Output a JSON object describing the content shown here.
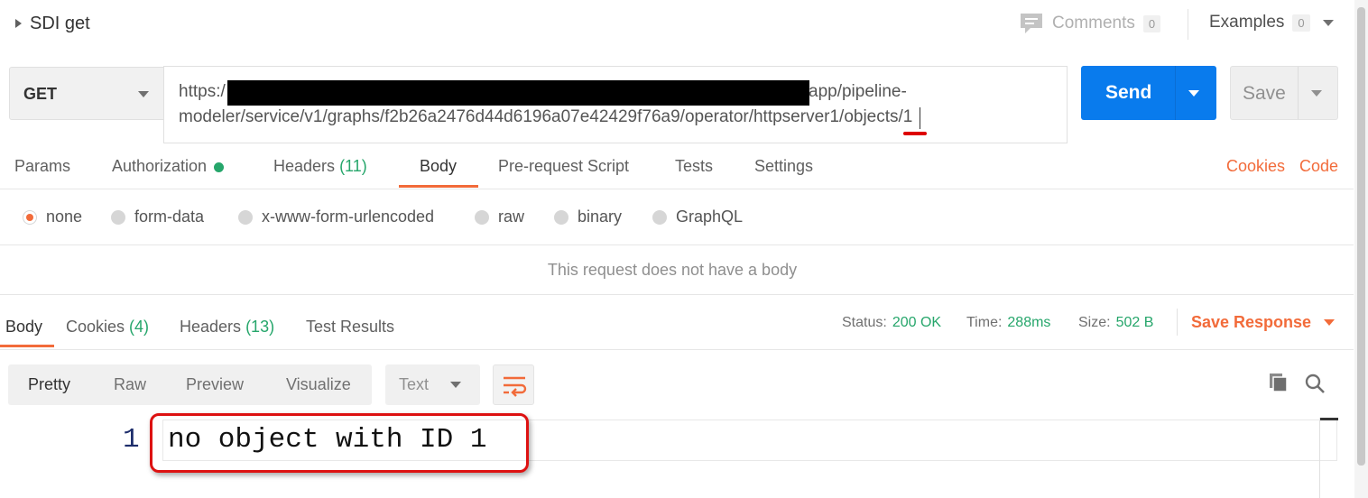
{
  "header": {
    "title": "SDI get",
    "comments_label": "Comments",
    "comments_count": "0",
    "examples_label": "Examples",
    "examples_count": "0"
  },
  "request": {
    "method": "GET",
    "url_line1_start": "https:/",
    "url_line1_end": "app/pipeline-",
    "url_line2": "modeler/service/v1/graphs/f2b26a2476d44d6196a07e42429f76a9/operator/httpserver1/objects/1",
    "send_label": "Send",
    "save_label": "Save"
  },
  "request_tabs": {
    "params": "Params",
    "authorization": "Authorization",
    "headers": "Headers",
    "headers_count": "(11)",
    "body": "Body",
    "pre_request": "Pre-request Script",
    "tests": "Tests",
    "settings": "Settings",
    "cookies_link": "Cookies",
    "code_link": "Code"
  },
  "body_types": {
    "selected": "none",
    "options": [
      "none",
      "form-data",
      "x-www-form-urlencoded",
      "raw",
      "binary",
      "GraphQL"
    ]
  },
  "no_body_message": "This request does not have a body",
  "response_tabs": {
    "body": "Body",
    "cookies": "Cookies",
    "cookies_count": "(4)",
    "headers": "Headers",
    "headers_count": "(13)",
    "test_results": "Test Results"
  },
  "response_status": {
    "status_label": "Status:",
    "status_value": "200 OK",
    "time_label": "Time:",
    "time_value": "288ms",
    "size_label": "Size:",
    "size_value": "502 B",
    "save_response": "Save Response"
  },
  "response_view": {
    "options": [
      "Pretty",
      "Raw",
      "Preview",
      "Visualize"
    ],
    "selected": "Pretty",
    "format": "Text"
  },
  "response_body": {
    "line_number": "1",
    "content": "no object with ID 1"
  },
  "colors": {
    "accent_orange": "#f26b3a",
    "send_blue": "#097bed",
    "success_green": "#26a66b",
    "annotation_red": "#d11111"
  }
}
